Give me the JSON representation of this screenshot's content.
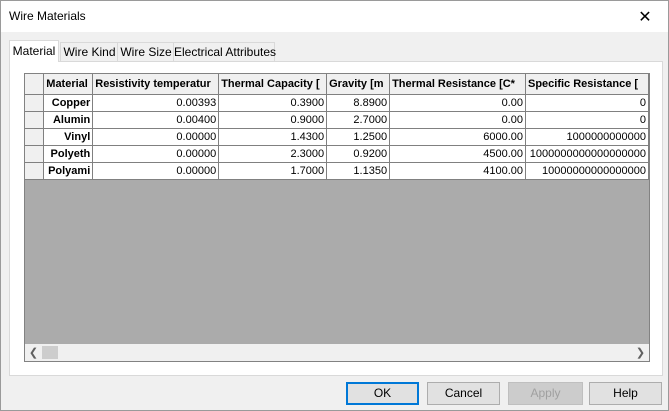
{
  "window": {
    "title": "Wire Materials"
  },
  "tabs": [
    "Material",
    "Wire Kind",
    "Wire Size",
    "Electrical Attributes"
  ],
  "grid": {
    "columns": [
      "Material",
      "Resistivity temperatur",
      "Thermal Capacity [",
      "Gravity [m",
      "Thermal Resistance [C*",
      "Specific Resistance ["
    ],
    "rows": [
      [
        "Copper",
        "0.00393",
        "0.3900",
        "8.8900",
        "0.00",
        "0"
      ],
      [
        "Alumin",
        "0.00400",
        "0.9000",
        "2.7000",
        "0.00",
        "0"
      ],
      [
        "Vinyl",
        "0.00000",
        "1.4300",
        "1.2500",
        "6000.00",
        "1000000000000"
      ],
      [
        "Polyeth",
        "0.00000",
        "2.3000",
        "0.9200",
        "4500.00",
        "1000000000000000000"
      ],
      [
        "Polyami",
        "0.00000",
        "1.7000",
        "1.1350",
        "4100.00",
        "10000000000000000"
      ]
    ]
  },
  "buttons": {
    "ok": "OK",
    "cancel": "Cancel",
    "apply": "Apply",
    "help": "Help"
  }
}
